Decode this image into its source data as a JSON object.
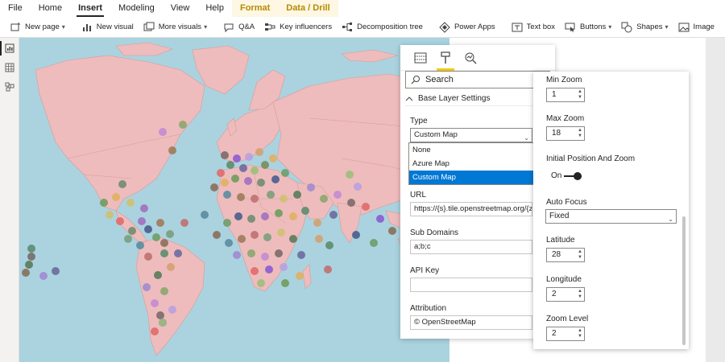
{
  "menubar": {
    "items": [
      {
        "label": "File"
      },
      {
        "label": "Home"
      },
      {
        "label": "Insert"
      },
      {
        "label": "Modeling"
      },
      {
        "label": "View"
      },
      {
        "label": "Help"
      },
      {
        "label": "Format"
      },
      {
        "label": "Data / Drill"
      }
    ],
    "active": "Insert"
  },
  "ribbon": {
    "new_page": "New page",
    "new_visual": "New visual",
    "more_visuals": "More visuals",
    "qa": "Q&A",
    "key_influencers": "Key influencers",
    "decomposition_tree": "Decomposition tree",
    "power_apps": "Power Apps",
    "text_box": "Text box",
    "buttons": "Buttons",
    "shapes": "Shapes",
    "image": "Image"
  },
  "format_pane": {
    "search_placeholder": "Search",
    "section": "Base Layer Settings",
    "type_label": "Type",
    "type_value": "Custom Map",
    "type_options": [
      "None",
      "Azure Map",
      "Custom Map"
    ],
    "url_label": "URL",
    "url_value": "https://{s}.tile.openstreetmap.org/{z}/{x}/{y}.png",
    "subdomains_label": "Sub Domains",
    "subdomains_value": "a;b;c",
    "apikey_label": "API Key",
    "apikey_value": "",
    "attribution_label": "Attribution",
    "attribution_value": "© OpenStreetMap"
  },
  "settings_pane": {
    "min_zoom_label": "Min Zoom",
    "min_zoom_value": "1",
    "max_zoom_label": "Max Zoom",
    "max_zoom_value": "18",
    "initial_label": "Initial Position And Zoom",
    "initial_toggle": "On",
    "autofocus_label": "Auto Focus",
    "autofocus_value": "Fixed",
    "latitude_label": "Latitude",
    "latitude_value": "28",
    "longitude_label": "Longitude",
    "longitude_value": "2",
    "zoom_label": "Zoom Level",
    "zoom_value": "2"
  },
  "colors": {
    "ocean": "#aad3df",
    "land": "#eebcbc",
    "accent": "#f2c811",
    "selection": "#0078d4"
  }
}
